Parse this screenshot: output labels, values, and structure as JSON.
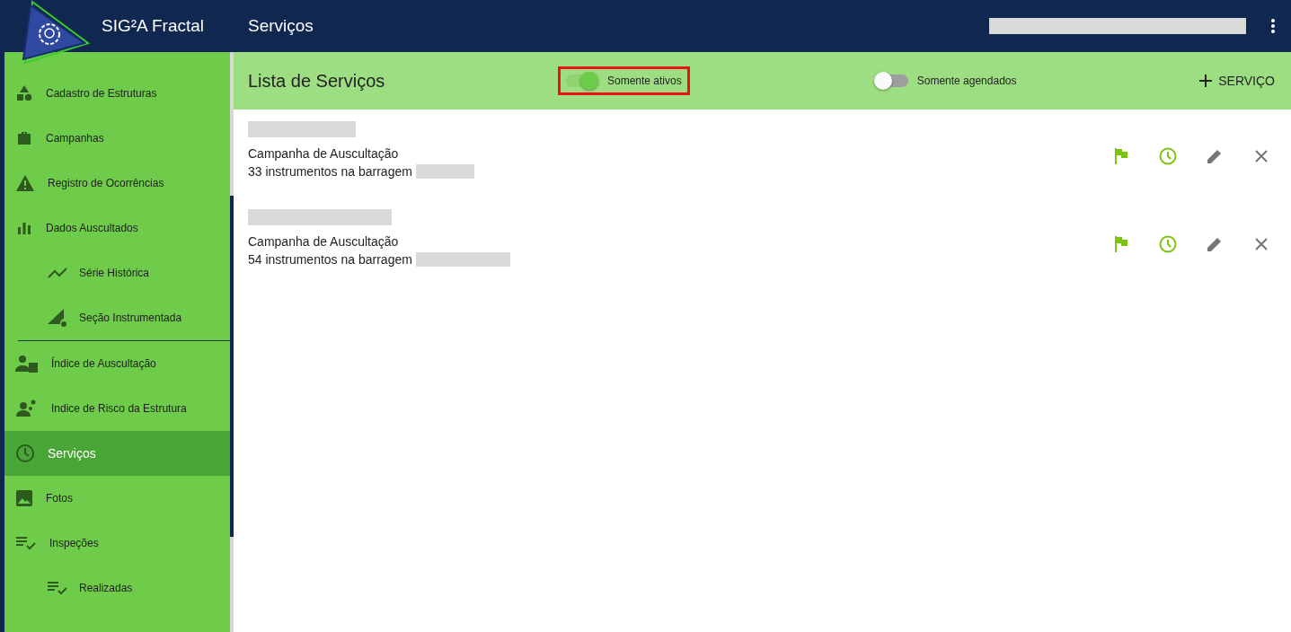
{
  "header": {
    "app_title": "SIG²A Fractal",
    "page_title": "Serviços"
  },
  "sidebar": {
    "items": [
      {
        "label": "Cadastro de Estruturas",
        "selected": false,
        "kind": "item"
      },
      {
        "label": "Campanhas",
        "selected": false,
        "kind": "item"
      },
      {
        "label": "Registro de Ocorrências",
        "selected": false,
        "kind": "item"
      },
      {
        "label": "Dados Auscultados",
        "selected": false,
        "kind": "item"
      },
      {
        "label": "Série Histórica",
        "selected": false,
        "kind": "subitem"
      },
      {
        "label": "Seção Instrumentada",
        "selected": false,
        "kind": "subitem"
      },
      {
        "label": "Índice de Auscultação",
        "selected": false,
        "kind": "item"
      },
      {
        "label": "Indice de Risco da Estrutura",
        "selected": false,
        "kind": "item"
      },
      {
        "label": "Serviços",
        "selected": true,
        "kind": "item"
      },
      {
        "label": "Fotos",
        "selected": false,
        "kind": "item"
      },
      {
        "label": "Inspeções",
        "selected": false,
        "kind": "item"
      },
      {
        "label": "Realizadas",
        "selected": false,
        "kind": "subitem"
      }
    ]
  },
  "toolbar": {
    "title": "Lista de Serviços",
    "toggles": [
      {
        "label": "Somente ativos",
        "on": true,
        "highlighted": true
      },
      {
        "label": "Somente agendados",
        "on": false,
        "highlighted": false
      }
    ],
    "add_button": "SERVIÇO"
  },
  "services": [
    {
      "type": "Campanha de Auscultação",
      "instruments": "33 instrumentos na barragem"
    },
    {
      "type": "Campanha de Auscultação",
      "instruments": "54 instrumentos na barragem"
    }
  ]
}
